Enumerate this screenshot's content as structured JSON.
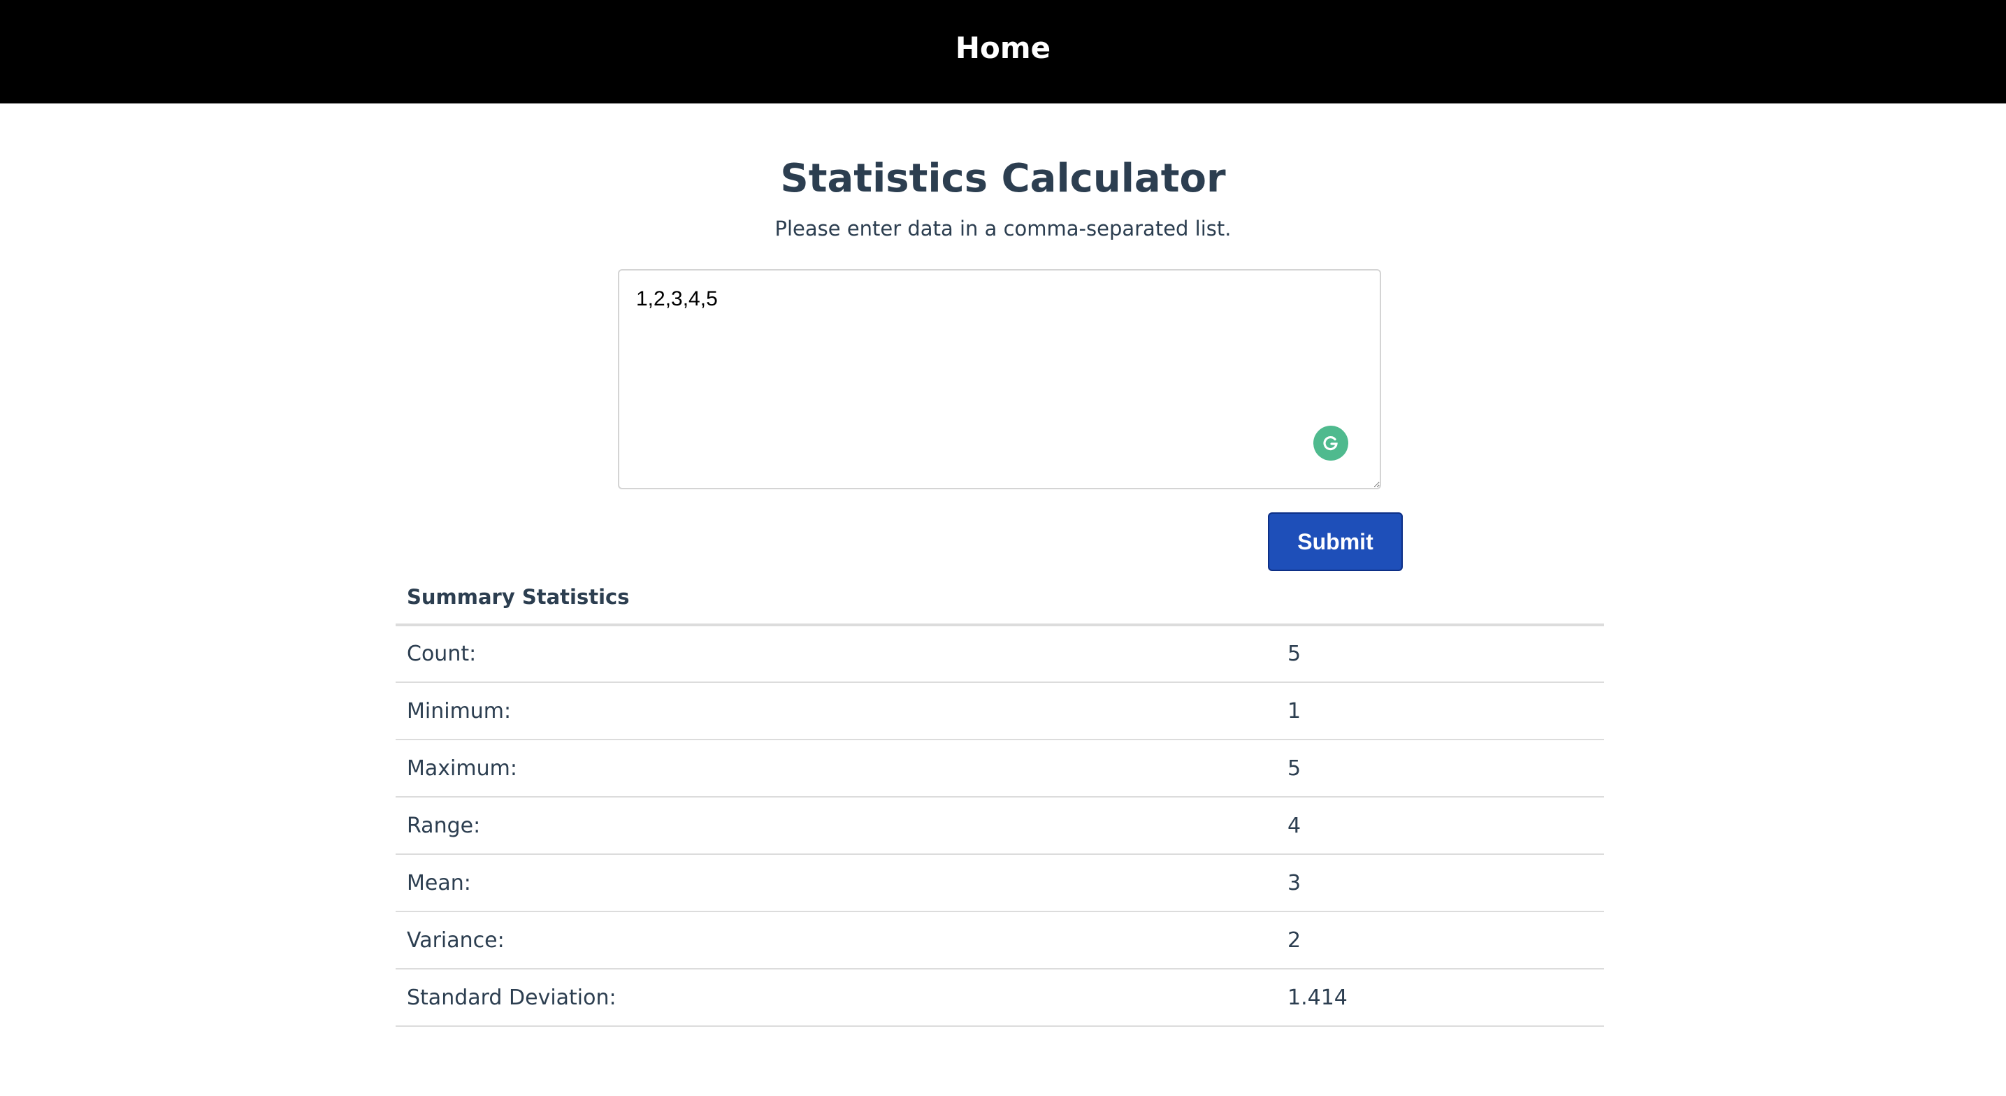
{
  "nav": {
    "home_label": "Home"
  },
  "page": {
    "title": "Statistics Calculator",
    "subtitle": "Please enter data in a comma-separated list."
  },
  "data_input": {
    "value": "1,2,3,4,5"
  },
  "form": {
    "submit_label": "Submit"
  },
  "summary": {
    "heading": "Summary Statistics",
    "rows": [
      {
        "label": "Count:",
        "value": "5"
      },
      {
        "label": "Minimum:",
        "value": "1"
      },
      {
        "label": "Maximum:",
        "value": "5"
      },
      {
        "label": "Range:",
        "value": "4"
      },
      {
        "label": "Mean:",
        "value": "3"
      },
      {
        "label": "Variance:",
        "value": "2"
      },
      {
        "label": "Standard Deviation:",
        "value": "1.414"
      }
    ]
  },
  "icons": {
    "grammarly": "grammarly-icon"
  },
  "colors": {
    "navbar": "#000000",
    "submit": "#1e4fb9",
    "grammarly": "#4fba8e",
    "text": "#2c3e50"
  }
}
